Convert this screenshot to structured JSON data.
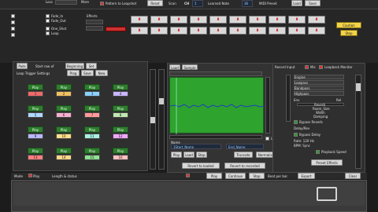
{
  "top": {
    "label_loss": "Loss",
    "label_more": "More",
    "label_pattern": "Pattern to Loopshot",
    "label_reset": "Reset",
    "label_scan": "Scan",
    "label_ch": "CH",
    "ch_value": "1",
    "label_learned_note": "Learned Note",
    "learned_note_value": "36",
    "label_midi_preset": "MIDI Preset",
    "btn_load": "Load",
    "btn_save": "Save"
  },
  "left_toggles": [
    {
      "label": "Fade_In"
    },
    {
      "label": "Fade_Out"
    },
    {
      "label": "One_Shot"
    },
    {
      "label": "Loop"
    }
  ],
  "effects_label": "Effects",
  "seg_display": [
    "8",
    "8",
    "8",
    "8",
    "8",
    "8",
    "8",
    "8",
    "8",
    "8",
    "8",
    "8",
    "8",
    "8",
    "8",
    "8",
    "8",
    "8",
    "8",
    "8"
  ],
  "btn_caution": "Caution",
  "btn_stop": "Stop",
  "pads_header": {
    "tab": "Pads",
    "label_start": "Start row of",
    "select_value": "Beginning",
    "btn_set": "Set",
    "label_trigger": "Loop Trigger Settings",
    "btn_prog": "Prog",
    "btn_save": "Save",
    "btn_new": "New"
  },
  "pads": [
    {
      "play": "Play",
      "num": "1",
      "color": "#f06a6a"
    },
    {
      "play": "Play",
      "num": "2",
      "color": "#f0c060"
    },
    {
      "play": "Play",
      "num": "3",
      "color": "#8ad0ff"
    },
    {
      "play": "Play",
      "num": "4",
      "color": "#c8b6ff"
    },
    {
      "play": "Play",
      "num": "5",
      "color": "#b0d8ff"
    },
    {
      "play": "Play",
      "num": "6",
      "color": "#f7b0d0"
    },
    {
      "play": "Play",
      "num": "7",
      "color": "#ff9a9a"
    },
    {
      "play": "Play",
      "num": "8",
      "color": "#c0e8b0"
    },
    {
      "play": "Play",
      "num": "9",
      "color": "#b8b8ff"
    },
    {
      "play": "Play",
      "num": "10",
      "color": "#ffe08a"
    },
    {
      "play": "Play",
      "num": "11",
      "color": "#a8f0e0"
    },
    {
      "play": "Play",
      "num": "12",
      "color": "#f0a8ff"
    },
    {
      "play": "Play",
      "num": "13",
      "color": "#ff8080"
    },
    {
      "play": "Play",
      "num": "14",
      "color": "#ffd88a"
    },
    {
      "play": "Play",
      "num": "15",
      "color": "#90e090"
    },
    {
      "play": "Play",
      "num": "16",
      "color": "#ffc0c0"
    }
  ],
  "wave_header": {
    "tab_load": "Load",
    "tab_sample": "Sample",
    "label_record": "Record Input",
    "label_mic": "Mic",
    "label_loopback": "Loopback Monitor"
  },
  "right_controls": {
    "items": [
      "Engine",
      "Lowpass",
      "Bandpass",
      "Highpass"
    ],
    "label_env": "Env",
    "label_rel": "Rel",
    "params": [
      "Reverb",
      "Room_Size",
      "Width",
      "Damping"
    ],
    "checks": [
      "Bypass Reverb",
      "Bypass Delay"
    ],
    "label_delay": "Delay/Rev",
    "label_rate": "Rate: 120 Hz",
    "label_bpm": "BPM: Sync",
    "label_playback": "Playback Speed",
    "btn_preset": "Preset Effects"
  },
  "wave_controls": {
    "field_name": "Name",
    "field_value": "1Start_Name",
    "field_end": "End_Name",
    "label_loop": "Loop",
    "btns": [
      "Play",
      "Load",
      "Stop",
      "Truncate",
      "Normalize"
    ],
    "btn_revert": "Revert to loaded",
    "btn_revert_rec": "Revert to recorded"
  },
  "transport": {
    "label_mode": "Mode",
    "label_play": "Play",
    "label_info": "Length & status",
    "btn_play": "Play",
    "btn_continue": "Continue",
    "btn_stop": "Stop",
    "label_beat": "Beat per bar",
    "btn_export": "Export",
    "btn_clear": "Clear"
  },
  "colors": {
    "wave_bg": "#2ea32e",
    "wave_line": "#1f3fbf",
    "accent_yellow": "#f2d34a"
  }
}
